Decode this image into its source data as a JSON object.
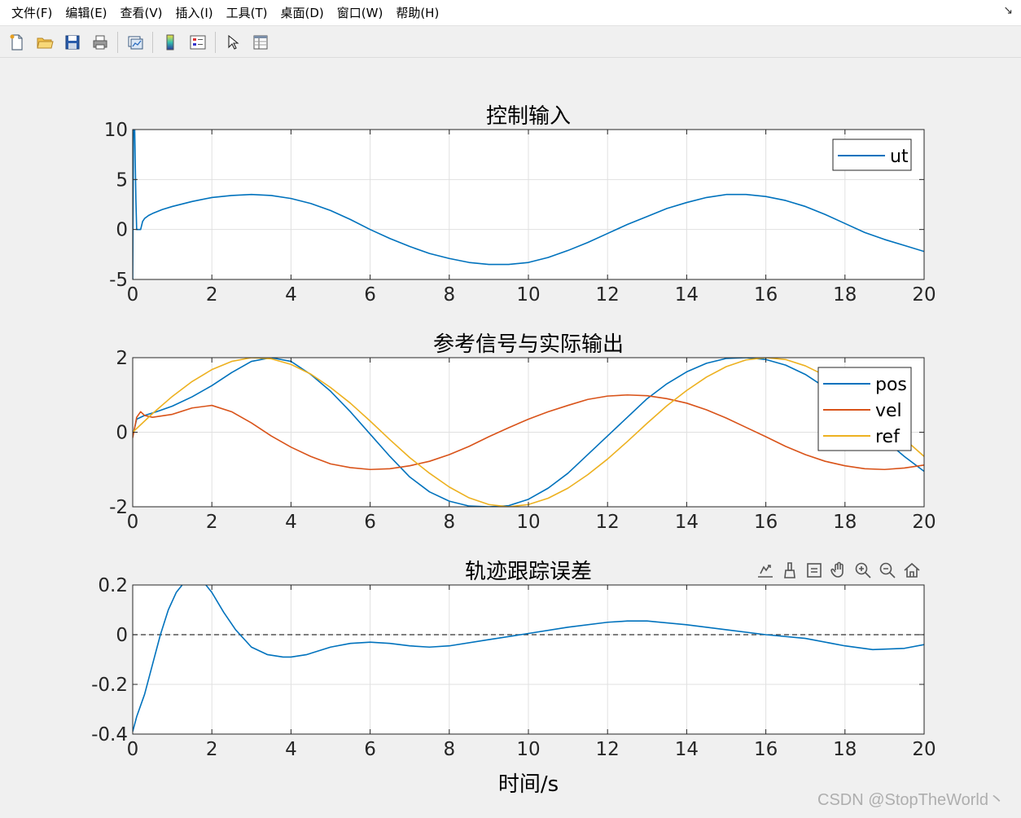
{
  "menu": {
    "items": [
      "文件(F)",
      "编辑(E)",
      "查看(V)",
      "插入(I)",
      "工具(T)",
      "桌面(D)",
      "窗口(W)",
      "帮助(H)"
    ],
    "arrow": "↘"
  },
  "toolbar": {
    "icons": [
      "new-file-icon",
      "open-folder-icon",
      "save-icon",
      "print-icon",
      "link-plot-icon",
      "colorbar-icon",
      "legend-icon",
      "pointer-icon",
      "property-inspector-icon"
    ]
  },
  "axes_toolbar": {
    "icons": [
      "export-icon",
      "brush-icon",
      "data-tips-icon",
      "pan-icon",
      "zoom-in-icon",
      "zoom-out-icon",
      "home-icon"
    ]
  },
  "watermark": "CSDN @StopTheWorld丶",
  "colors": {
    "series1": "#0072BD",
    "series2": "#D95319",
    "series3": "#EDB120",
    "grid": "#e0e0e0",
    "axes_bg": "#ffffff",
    "figure_bg": "#f0f0f0"
  },
  "chart_data": [
    {
      "type": "line",
      "title": "控制输入",
      "xlabel": "",
      "ylabel": "",
      "xlim": [
        0,
        20
      ],
      "ylim": [
        -5,
        10
      ],
      "xticks": [
        0,
        2,
        4,
        6,
        8,
        10,
        12,
        14,
        16,
        18,
        20
      ],
      "yticks": [
        -5,
        0,
        5,
        10
      ],
      "grid": true,
      "legend": "top-right",
      "series": [
        {
          "name": "ut",
          "color": "#0072BD",
          "x": [
            0,
            0.02,
            0.05,
            0.08,
            0.1,
            0.15,
            0.2,
            0.25,
            0.3,
            0.4,
            0.5,
            0.75,
            1,
            1.5,
            2,
            2.5,
            3,
            3.5,
            4,
            4.5,
            5,
            5.5,
            6,
            6.5,
            7,
            7.5,
            8,
            8.5,
            9,
            9.5,
            10,
            10.5,
            11,
            11.5,
            12,
            12.5,
            13,
            13.5,
            14,
            14.5,
            15,
            15.5,
            16,
            16.5,
            17,
            17.5,
            18,
            18.5,
            19,
            19.5,
            20
          ],
          "y": [
            -5,
            10,
            10,
            3,
            0,
            0,
            0,
            0.8,
            1.1,
            1.4,
            1.6,
            2.0,
            2.3,
            2.8,
            3.2,
            3.4,
            3.5,
            3.4,
            3.1,
            2.6,
            1.9,
            1.0,
            0.0,
            -0.9,
            -1.7,
            -2.4,
            -2.9,
            -3.3,
            -3.5,
            -3.5,
            -3.3,
            -2.8,
            -2.1,
            -1.3,
            -0.4,
            0.5,
            1.3,
            2.1,
            2.7,
            3.2,
            3.5,
            3.5,
            3.3,
            2.9,
            2.3,
            1.5,
            0.6,
            -0.3,
            -1.0,
            -1.6,
            -2.2
          ]
        }
      ]
    },
    {
      "type": "line",
      "title": "参考信号与实际输出",
      "xlabel": "",
      "ylabel": "",
      "xlim": [
        0,
        20
      ],
      "ylim": [
        -2,
        2
      ],
      "xticks": [
        0,
        2,
        4,
        6,
        8,
        10,
        12,
        14,
        16,
        18,
        20
      ],
      "yticks": [
        -2,
        0,
        2
      ],
      "grid": true,
      "legend": "top-right",
      "series": [
        {
          "name": "pos",
          "color": "#0072BD",
          "x": [
            0,
            0.1,
            0.3,
            0.6,
            1,
            1.5,
            2,
            2.5,
            3,
            3.5,
            4,
            4.5,
            5,
            5.5,
            6,
            6.5,
            7,
            7.5,
            8,
            8.5,
            9,
            9.5,
            10,
            10.5,
            11,
            11.5,
            12,
            12.5,
            13,
            13.5,
            14,
            14.5,
            15,
            15.5,
            16,
            16.5,
            17,
            17.5,
            18,
            18.5,
            19,
            19.5,
            20
          ],
          "y": [
            -0.1,
            0.35,
            0.45,
            0.55,
            0.7,
            0.95,
            1.25,
            1.6,
            1.9,
            2.0,
            1.9,
            1.55,
            1.1,
            0.55,
            -0.05,
            -0.65,
            -1.2,
            -1.6,
            -1.85,
            -1.98,
            -2.0,
            -1.97,
            -1.8,
            -1.5,
            -1.1,
            -0.6,
            -0.1,
            0.4,
            0.9,
            1.3,
            1.62,
            1.85,
            1.98,
            2.0,
            1.95,
            1.8,
            1.55,
            1.2,
            0.78,
            0.3,
            -0.2,
            -0.65,
            -1.05
          ]
        },
        {
          "name": "vel",
          "color": "#D95319",
          "x": [
            0,
            0.1,
            0.2,
            0.3,
            0.5,
            1,
            1.5,
            2,
            2.5,
            3,
            3.5,
            4,
            4.5,
            5,
            5.5,
            6,
            6.5,
            7,
            7.5,
            8,
            8.5,
            9,
            9.5,
            10,
            10.5,
            11,
            11.5,
            12,
            12.5,
            13,
            13.5,
            14,
            14.5,
            15,
            15.5,
            16,
            16.5,
            17,
            17.5,
            18,
            18.5,
            19,
            19.5,
            20
          ],
          "y": [
            -0.15,
            0.4,
            0.55,
            0.45,
            0.4,
            0.48,
            0.65,
            0.72,
            0.55,
            0.25,
            -0.1,
            -0.4,
            -0.65,
            -0.85,
            -0.95,
            -1.0,
            -0.98,
            -0.9,
            -0.78,
            -0.6,
            -0.38,
            -0.12,
            0.12,
            0.35,
            0.55,
            0.72,
            0.88,
            0.97,
            1.0,
            0.98,
            0.9,
            0.78,
            0.6,
            0.38,
            0.13,
            -0.12,
            -0.38,
            -0.6,
            -0.78,
            -0.9,
            -0.98,
            -1.0,
            -0.96,
            -0.88
          ]
        },
        {
          "name": "ref",
          "color": "#EDB120",
          "x": [
            0,
            0.5,
            1,
            1.5,
            2,
            2.5,
            3,
            3.5,
            4,
            4.5,
            5,
            5.5,
            6,
            6.5,
            7,
            7.5,
            8,
            8.5,
            9,
            9.5,
            10,
            10.5,
            11,
            11.5,
            12,
            12.5,
            13,
            13.5,
            14,
            14.5,
            15,
            15.5,
            16,
            16.5,
            17,
            17.5,
            18,
            18.5,
            19,
            19.5,
            20
          ],
          "y": [
            0.0,
            0.5,
            0.96,
            1.36,
            1.68,
            1.9,
            2.0,
            1.97,
            1.82,
            1.56,
            1.2,
            0.78,
            0.3,
            -0.2,
            -0.68,
            -1.1,
            -1.47,
            -1.76,
            -1.94,
            -2.0,
            -1.94,
            -1.77,
            -1.5,
            -1.14,
            -0.72,
            -0.25,
            0.24,
            0.71,
            1.12,
            1.48,
            1.76,
            1.94,
            2.0,
            1.95,
            1.78,
            1.52,
            1.17,
            0.76,
            0.3,
            -0.18,
            -0.65
          ]
        }
      ]
    },
    {
      "type": "line",
      "title": "轨迹跟踪误差",
      "xlabel": "时间/s",
      "ylabel": "",
      "xlim": [
        0,
        20
      ],
      "ylim": [
        -0.4,
        0.2
      ],
      "xticks": [
        0,
        2,
        4,
        6,
        8,
        10,
        12,
        14,
        16,
        18,
        20
      ],
      "yticks": [
        -0.4,
        -0.2,
        0,
        0.2
      ],
      "ytick_labels": [
        "-0.4",
        "-0.2",
        "0",
        "0.2"
      ],
      "grid": true,
      "legend": "none",
      "reference_line": {
        "y": 0,
        "style": "dashed",
        "color": "#333333"
      },
      "series": [
        {
          "color": "#0072BD",
          "x": [
            0,
            0.1,
            0.3,
            0.5,
            0.7,
            0.9,
            1.1,
            1.3,
            1.5,
            1.6,
            1.8,
            2.0,
            2.3,
            2.6,
            3.0,
            3.4,
            3.8,
            4.0,
            4.4,
            5.0,
            5.5,
            6.0,
            6.5,
            7.0,
            7.5,
            8.0,
            9.0,
            10.0,
            11.0,
            12.0,
            12.5,
            13.0,
            14.0,
            15.0,
            16.0,
            17.0,
            18.0,
            18.7,
            19.5,
            20.0
          ],
          "y": [
            -0.39,
            -0.33,
            -0.24,
            -0.12,
            0.0,
            0.1,
            0.17,
            0.21,
            0.225,
            0.225,
            0.21,
            0.17,
            0.09,
            0.02,
            -0.05,
            -0.08,
            -0.09,
            -0.09,
            -0.08,
            -0.05,
            -0.035,
            -0.03,
            -0.035,
            -0.045,
            -0.05,
            -0.045,
            -0.02,
            0.005,
            0.03,
            0.05,
            0.055,
            0.055,
            0.04,
            0.02,
            0.0,
            -0.015,
            -0.045,
            -0.06,
            -0.055,
            -0.04
          ]
        }
      ]
    }
  ]
}
